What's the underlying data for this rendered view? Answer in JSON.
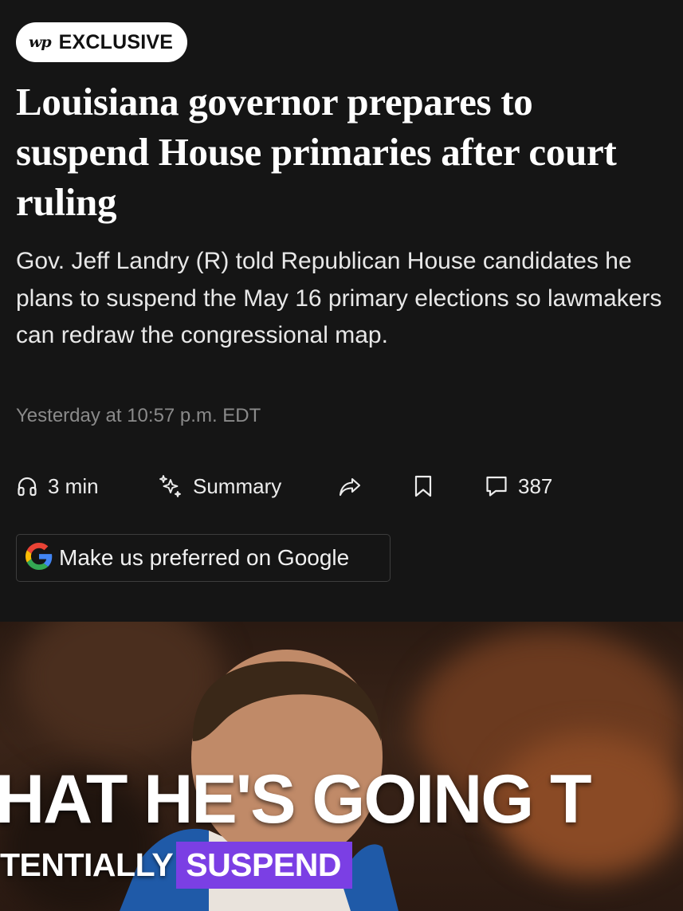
{
  "badge": {
    "logo_text": "wp",
    "label": "EXCLUSIVE"
  },
  "article": {
    "headline": "Louisiana governor prepares to suspend House primaries after court ruling",
    "dek": "Gov. Jeff Landry (R) told Republican House candidates he plans to suspend the May 16 primary elections so lawmakers can redraw the congressional map.",
    "timestamp": "Yesterday at 10:57 p.m. EDT"
  },
  "actions": {
    "listen": {
      "icon": "headphones-icon",
      "label": "3 min"
    },
    "summary": {
      "icon": "sparkle-icon",
      "label": "Summary"
    },
    "share": {
      "icon": "share-arrow-icon"
    },
    "save": {
      "icon": "bookmark-icon"
    },
    "comments": {
      "icon": "comment-icon",
      "count": "387"
    }
  },
  "preferred_button": {
    "icon": "google-g-icon",
    "label": "Make us preferred on Google"
  },
  "video": {
    "caption_main": "HAT HE'S GOING T",
    "caption_sub_plain": "TENTIALLY",
    "caption_sub_highlight": "SUSPEND"
  },
  "colors": {
    "background": "#151515",
    "caption_highlight": "#7b3fe4",
    "timestamp": "#8a8a8a"
  }
}
